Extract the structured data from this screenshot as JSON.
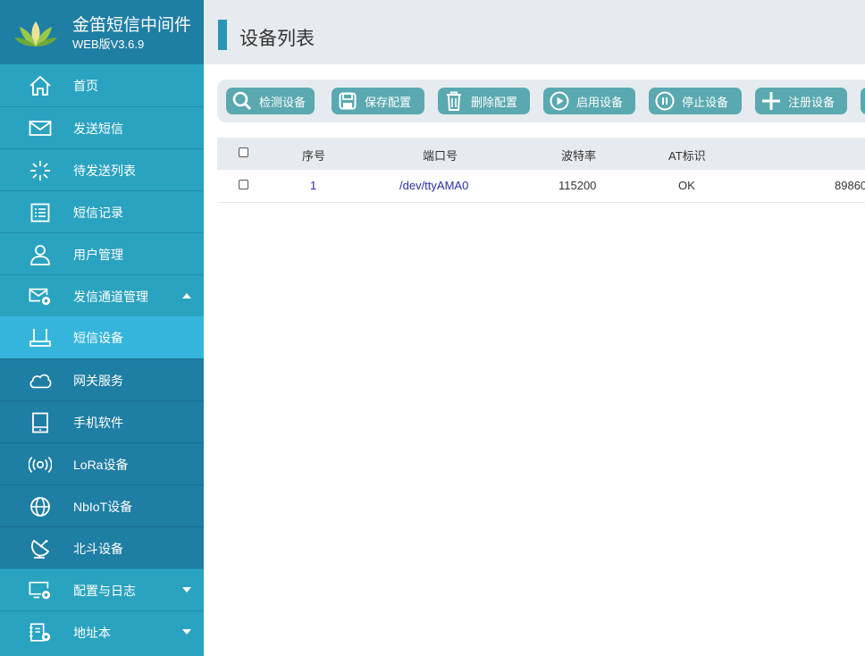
{
  "brand": {
    "title": "金笛短信中间件",
    "version": "WEB版V3.6.9"
  },
  "sidebar": {
    "items": [
      {
        "label": "首页",
        "icon": "home-icon"
      },
      {
        "label": "发送短信",
        "icon": "envelope-icon"
      },
      {
        "label": "待发送列表",
        "icon": "spinner-icon"
      },
      {
        "label": "短信记录",
        "icon": "list-icon"
      },
      {
        "label": "用户管理",
        "icon": "user-icon"
      },
      {
        "label": "发信通道管理",
        "icon": "mail-settings-icon"
      },
      {
        "label": "短信设备",
        "icon": "device-icon"
      },
      {
        "label": "网关服务",
        "icon": "cloud-icon"
      },
      {
        "label": "手机软件",
        "icon": "tablet-icon"
      },
      {
        "label": "LoRa设备",
        "icon": "signal-icon"
      },
      {
        "label": "NbIoT设备",
        "icon": "globe-icon"
      },
      {
        "label": "北斗设备",
        "icon": "satellite-icon"
      },
      {
        "label": "配置与日志",
        "icon": "monitor-settings-icon"
      },
      {
        "label": "地址本",
        "icon": "address-book-icon"
      }
    ]
  },
  "header": {
    "title": "设备列表"
  },
  "toolbar": {
    "buttons": [
      {
        "label": "检测设备",
        "icon": "search-icon"
      },
      {
        "label": "保存配置",
        "icon": "save-icon"
      },
      {
        "label": "删除配置",
        "icon": "trash-icon"
      },
      {
        "label": "启用设备",
        "icon": "play-icon"
      },
      {
        "label": "停止设备",
        "icon": "pause-icon"
      },
      {
        "label": "注册设备",
        "icon": "plus-icon"
      }
    ]
  },
  "table": {
    "columns": [
      "序号",
      "端口号",
      "波特率",
      "AT标识"
    ],
    "rows": [
      {
        "index": "1",
        "port": "/dev/ttyAMA0",
        "baud": "115200",
        "at": "OK",
        "extra": "89860"
      }
    ]
  },
  "colors": {
    "sidebar": "#2aa3c0",
    "brand": "#1f7ea4",
    "active": "#35b5db",
    "button": "#5aa9b0",
    "header": "#e6ebef"
  }
}
